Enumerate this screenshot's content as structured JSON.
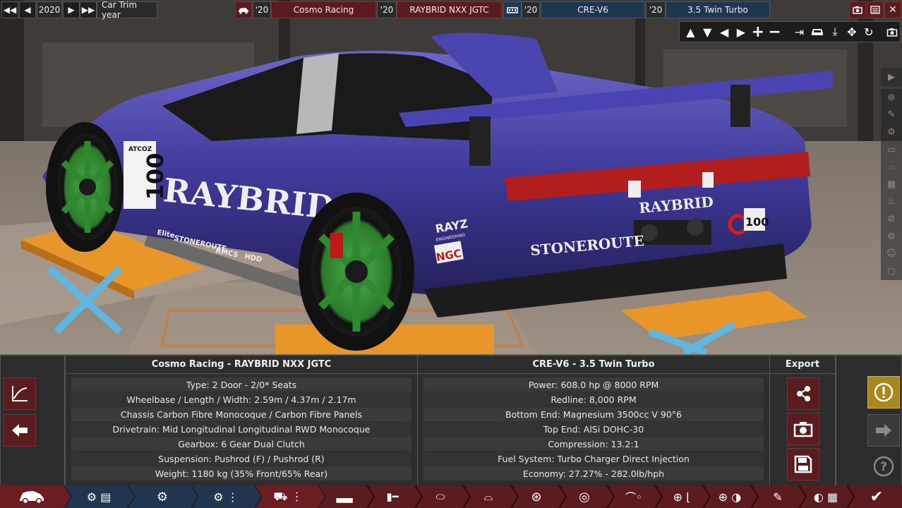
{
  "topbar": {
    "year_value": "2020",
    "trim_year_label": "Car Trim year",
    "car_model_year": "'20",
    "car_model": "Cosmo Racing",
    "car_trim_year": "'20",
    "car_trim": "RAYBRID NXX JGTC",
    "engine_family_year": "'20",
    "engine_family": "CRE-V6",
    "engine_variant_year": "'20",
    "engine_variant": "3.5 Twin Turbo"
  },
  "car_info": {
    "title": "Cosmo Racing - RAYBRID NXX JGTC",
    "rows": [
      "Type: 2 Door - 2/0* Seats",
      "Wheelbase / Length / Width: 2.59m / 4.37m / 2.17m",
      "Chassis Carbon Fibre Monocoque / Carbon Fibre Panels",
      "Drivetrain: Mid Longitudinal Longitudinal RWD Monocoque",
      "Gearbox: 6 Gear Dual Clutch",
      "Suspension: Pushrod (F) / Pushrod (R)",
      "Weight: 1180 kg (35% Front/65% Rear)"
    ]
  },
  "engine_info": {
    "title": "CRE-V6 - 3.5 Twin Turbo",
    "rows": [
      "Power: 608.0 hp @ 8000 RPM",
      "Redline:  8,000 RPM",
      "Bottom End: Magnesium 3500cc V 90°6",
      "Top End: AlSi DOHC-30",
      "Compression: 13.2:1",
      "Fuel System: Turbo Charger Direct Injection",
      "Economy: 27.27% - 282.0lb/hph"
    ]
  },
  "export": {
    "title": "Export"
  },
  "car_decals": {
    "number": "100",
    "brand": "RAYBRID",
    "rear_brand": "RAYBRID",
    "rear_sponsor": "STONEROUTE",
    "sponsor_rayz": "RAYZ",
    "sponsor_rayz_sub": "ENGINEERING",
    "sponsor_ngc": "NGC",
    "side_sponsors": [
      "Elite",
      "STONEROUTE",
      "RMCS",
      "HDD"
    ],
    "small_sponsor": "ATCOZ"
  },
  "colors": {
    "accent_red": "#5a1c1f",
    "accent_blue": "#1f3550",
    "warning_gold": "#a8871c",
    "car_body": "#3f3a9a",
    "wheels": "#3a8a3a",
    "lift": "#e8962a"
  }
}
